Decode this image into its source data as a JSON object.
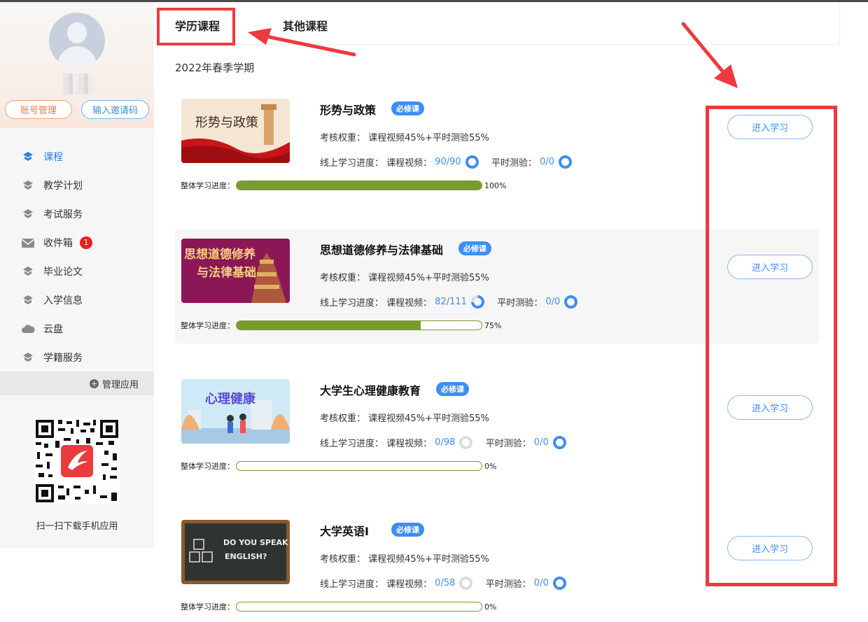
{
  "sidebar": {
    "account_btn": "账号管理",
    "invite_btn": "输入邀请码",
    "nav": [
      {
        "label": "课程",
        "icon": "course-icon",
        "active": true
      },
      {
        "label": "教学计划",
        "icon": "graduation-cap-icon"
      },
      {
        "label": "考试服务",
        "icon": "graduation-cap-icon"
      },
      {
        "label": "收件箱",
        "icon": "mail-icon",
        "badge": "1"
      },
      {
        "label": "毕业论文",
        "icon": "graduation-cap-icon"
      },
      {
        "label": "入学信息",
        "icon": "graduation-cap-icon"
      },
      {
        "label": "云盘",
        "icon": "cloud-icon"
      },
      {
        "label": "学籍服务",
        "icon": "graduation-cap-icon"
      }
    ],
    "manage_apps": "管理应用",
    "qr_caption": "扫一扫下载手机应用"
  },
  "tabs": {
    "degree": "学历课程",
    "other": "其他课程"
  },
  "term": "2022年春季学期",
  "labels": {
    "weight": "考核权重：",
    "online_progress": "线上学习进度：",
    "video": "课程视频：",
    "quiz": "平时测验：",
    "overall": "整体学习进度：",
    "required": "必修课",
    "enter": "进入学习"
  },
  "courses": [
    {
      "title": "形势与政策",
      "weight": "课程视频45%+平时测验55%",
      "video": "90/90",
      "video_pct": 100,
      "quiz": "0/0",
      "overall": 1.0,
      "overall_text": "100%"
    },
    {
      "title": "思想道德修养与法律基础",
      "weight": "课程视频45%+平时测验55%",
      "video": "82/111",
      "video_pct": 74,
      "quiz": "0/0",
      "overall": 0.75,
      "overall_text": "75%"
    },
    {
      "title": "大学生心理健康教育",
      "weight": "课程视频45%+平时测验55%",
      "video": "0/98",
      "video_pct": 0,
      "quiz": "0/0",
      "overall": 0.0,
      "overall_text": "0%"
    },
    {
      "title": "大学英语Ⅰ",
      "weight": "课程视频45%+平时测验55%",
      "video": "0/58",
      "video_pct": 0,
      "quiz": "0/0",
      "overall": 0.0,
      "overall_text": "0%"
    }
  ],
  "thumb_text": {
    "c0": "形势与政策",
    "c1a": "思想道德修养",
    "c1b": "与法律基础",
    "c2": "心理健康",
    "c3a": "DO YOU SPEAK",
    "c3b": "ENGLISH?"
  },
  "colors": {
    "accent": "#3e8ef0",
    "progress": "#799c2a",
    "highlight": "#ec3a3e"
  }
}
